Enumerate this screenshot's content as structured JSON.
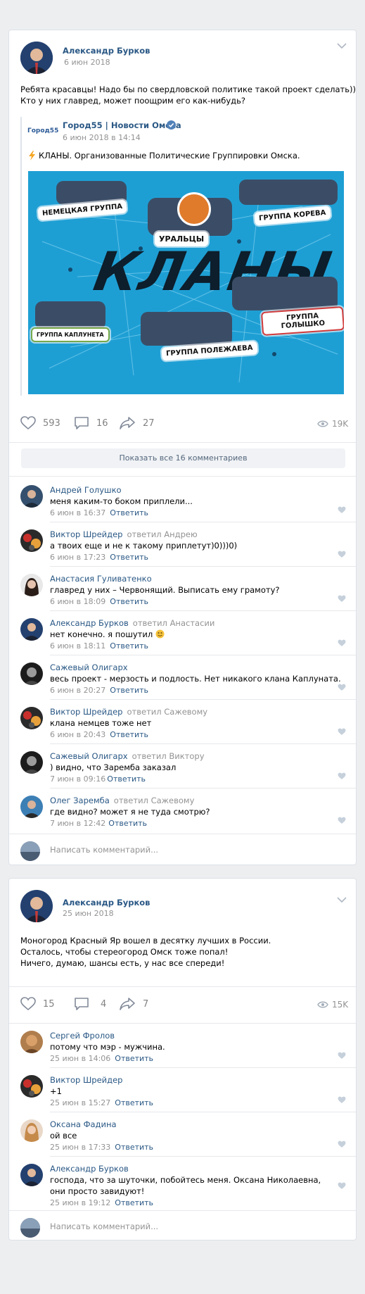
{
  "post1": {
    "author": "Александр Бурков",
    "date": "6 июн 2018",
    "text_line1": "Ребята красавцы! Надо бы по свердловской политике такой проект сделать))",
    "text_line2": "Кто у них главред, может поощрим его как-нибудь?",
    "repost": {
      "logo": "Город55",
      "source": "Город55 | Новости Омска",
      "date": "6 июн 2018 в 14:14",
      "text": "КЛАНЫ. Организованные Политические Группировки Омска.",
      "banner": {
        "title": "КЛАНЫ",
        "label_nemets": "НЕМЕЦКАЯ ГРУППА",
        "label_uraltsy": "УРАЛЬЦЫ",
        "label_koreva": "ГРУППА КОРЕВА",
        "label_kapluneta": "ГРУППА КАПЛУНЕТА",
        "label_golishko": "ГРУППА ГОЛЫШКО",
        "label_polezhaeva": "ГРУППА ПОЛЕЖАЕВА"
      }
    },
    "likes": "593",
    "comments": "16",
    "shares": "27",
    "views": "19K",
    "show_all": "Показать все 16 комментариев",
    "comments_list": [
      {
        "name": "Андрей Голушко",
        "reply": "",
        "text": "меня каким-то боком приплели...",
        "date": "6 июн в 16:37",
        "answer": "Ответить"
      },
      {
        "name": "Виктор Шрейдер",
        "reply": "ответил Андрею",
        "text": "а твоих еще и не к такому приплетут)0)))0)",
        "date": "6 июн в 17:23",
        "answer": "Ответить"
      },
      {
        "name": "Анастасия Гуливатенко",
        "reply": "",
        "text": "главред у них – Червонящий. Выписать ему грамоту?",
        "date": "6 июн в 18:09",
        "answer": "Ответить"
      },
      {
        "name": "Александр Бурков",
        "reply": "ответил Анастасии",
        "text": "нет конечно. я пошутил",
        "date": "6 июн в 18:11",
        "answer": "Ответить"
      },
      {
        "name": "Сажевый Олигарх",
        "reply": "",
        "text": "весь проект - мерзость и подлость. Нет никакого клана Каплуната.",
        "date": "6 июн в 20:27",
        "answer": "Ответить"
      },
      {
        "name": "Виктор Шрейдер",
        "reply": "ответил Сажевому",
        "text": "клана немцев тоже нет",
        "date": "6 июн в 20:43",
        "answer": "Ответить"
      },
      {
        "name": "Сажевый Олигарх",
        "reply": "ответил Виктору",
        "text": ") видно, что Заремба заказал",
        "date": "7 июн в 09:16",
        "answer": "Ответить"
      },
      {
        "name": "Олег Заремба",
        "reply": "ответил Сажевому",
        "text": "где видно? может я не туда смотрю?",
        "date": "7 июн в 12:42",
        "answer": "Ответить"
      }
    ],
    "write_placeholder": "Написать комментарий..."
  },
  "post2": {
    "author": "Александр Бурков",
    "date": "25 июн 2018",
    "text_line1": "Моногород Красный Яр вошел в десятку лучших в России.",
    "text_line2": "Осталось, чтобы стереогород Омск тоже попал!",
    "text_line3": "Ничего, думаю, шансы есть, у нас все спереди!",
    "likes": "15",
    "comments": "4",
    "shares": "7",
    "views": "15K",
    "comments_list": [
      {
        "name": "Сергей Фролов",
        "reply": "",
        "text": "потому что мэр - мужчина.",
        "text2": "",
        "date": "25 июн в 14:06",
        "answer": "Ответить"
      },
      {
        "name": "Виктор Шрейдер",
        "reply": "",
        "text": "+1",
        "text2": "",
        "date": "25 июн в 15:27",
        "answer": "Ответить"
      },
      {
        "name": "Оксана Фадина",
        "reply": "",
        "text": "ой все",
        "text2": "",
        "date": "25 июн в 17:33",
        "answer": "Ответить"
      },
      {
        "name": "Александр Бурков",
        "reply": "",
        "text": "господа, что за шуточки, побойтесь меня. Оксана Николаевна,",
        "text2": "они просто завидуют!",
        "date": "25 июн в 19:12",
        "answer": "Ответить"
      }
    ],
    "write_placeholder": "Написать комментарий..."
  },
  "colors": {
    "link": "#2a5885",
    "meta": "#939393",
    "banner_bg": "#1e9fd4",
    "verified": "#5181b8",
    "page_bg": "#edeef0"
  }
}
